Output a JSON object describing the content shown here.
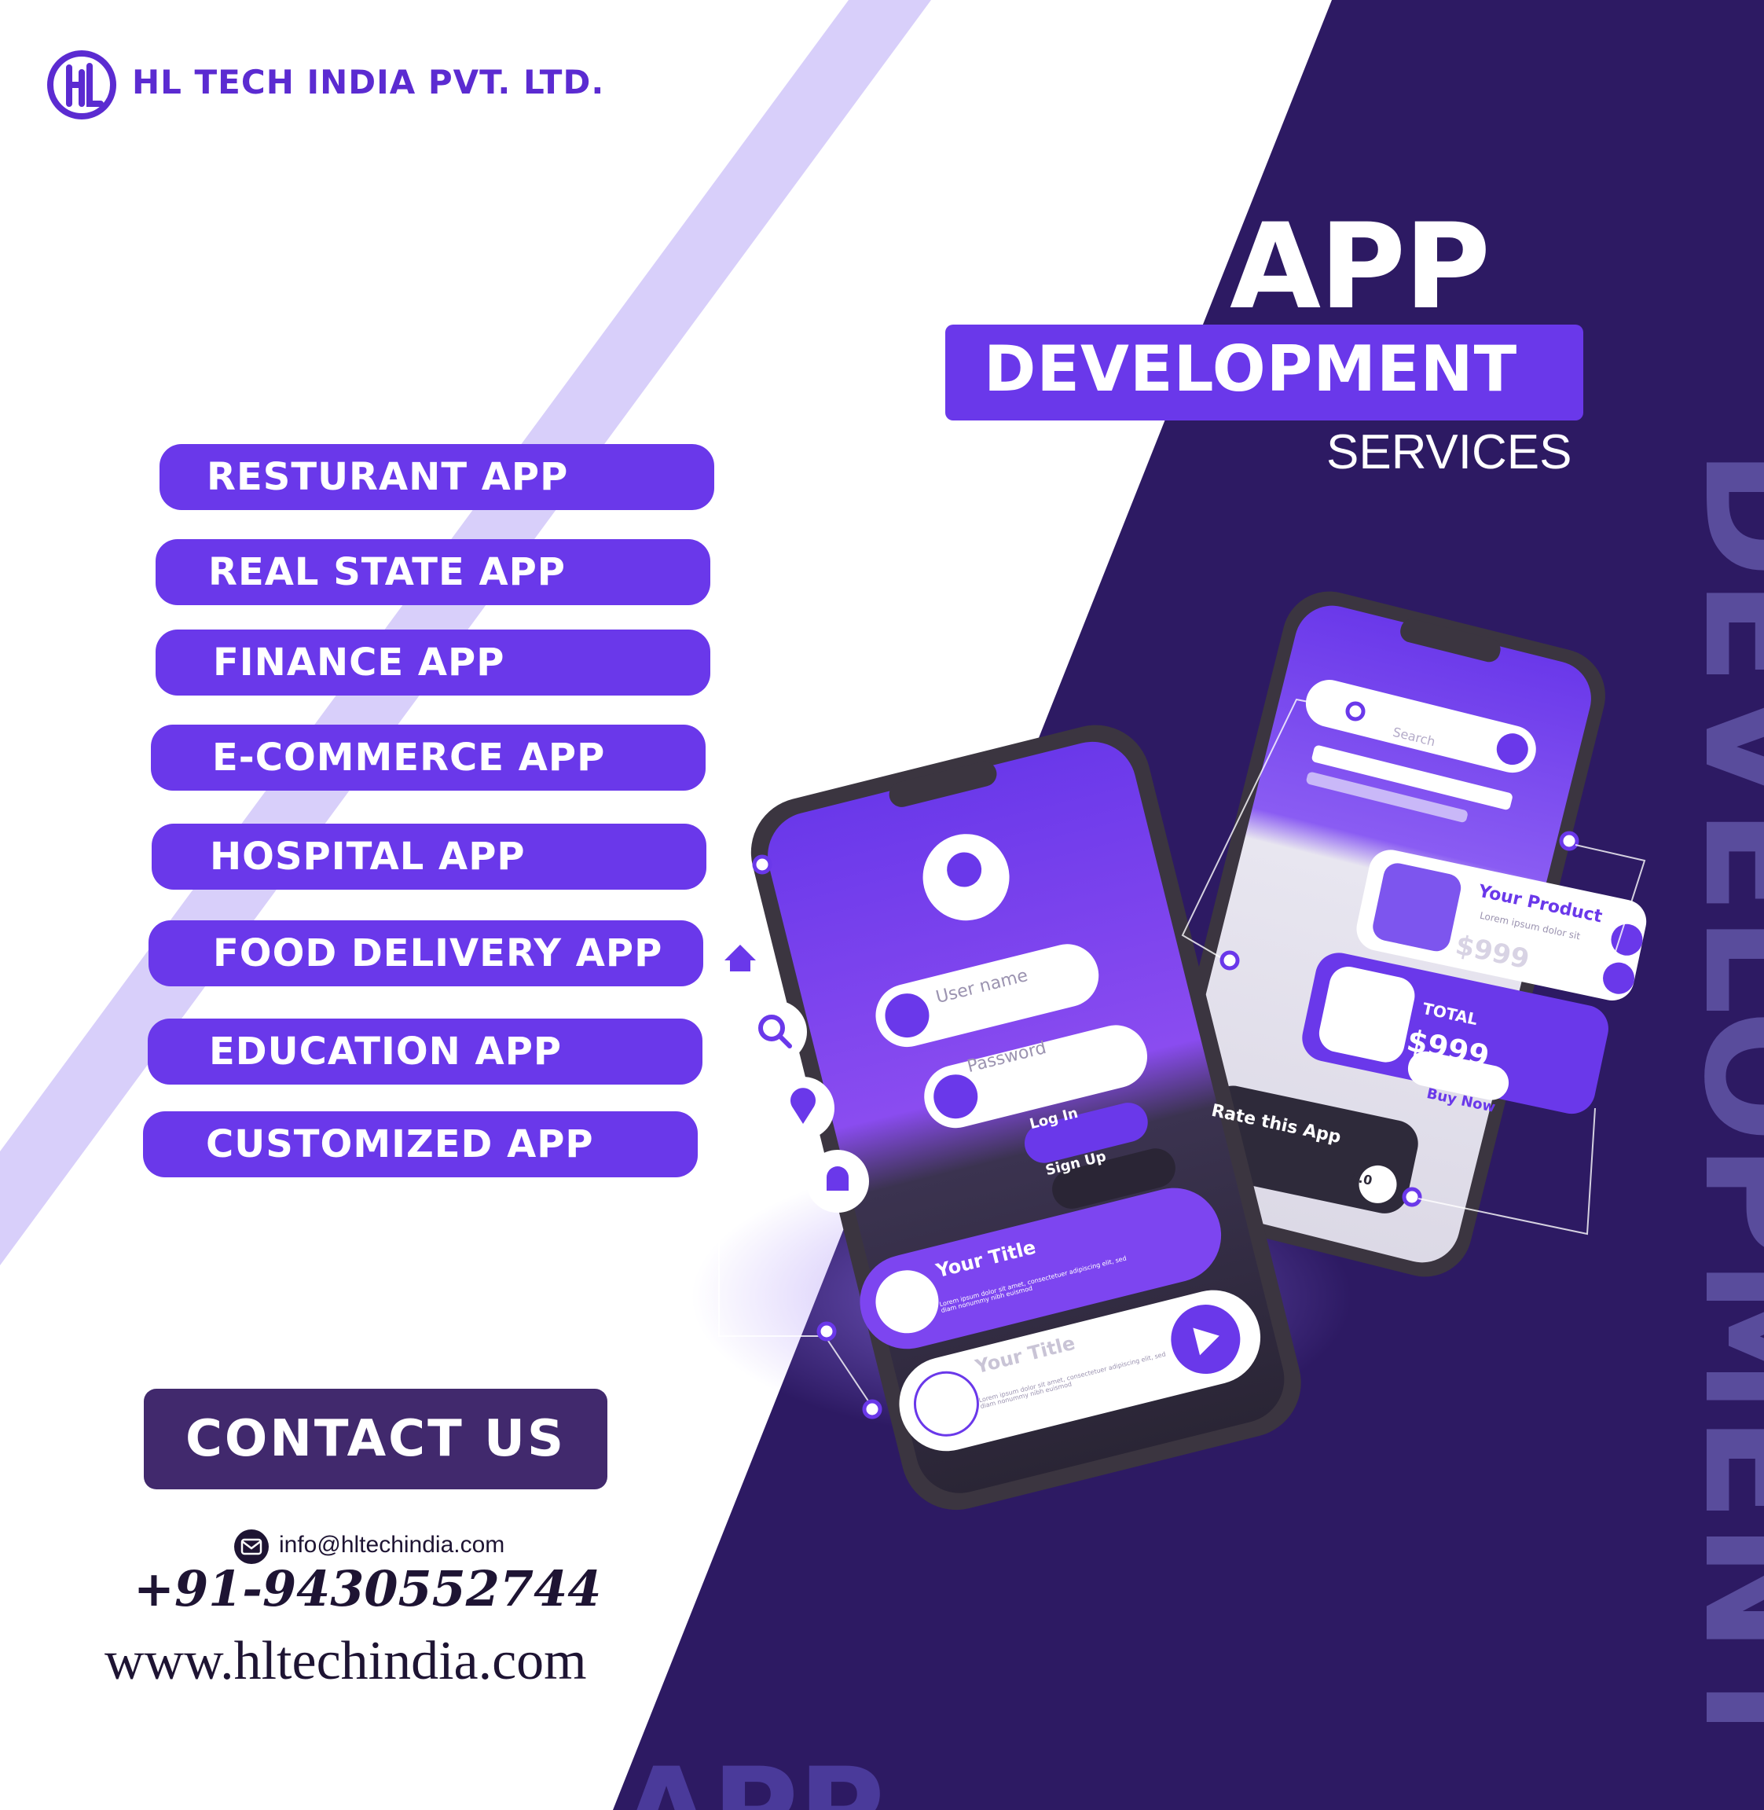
{
  "brand": {
    "name": "HL TECH INDIA PVT. LTD.",
    "logo_icon": "hl-monogram-icon"
  },
  "headline": {
    "line1": "APP",
    "line2": "DEVELOPMENT",
    "line3": "SERVICES"
  },
  "watermark": {
    "vertical": "DEVELOPMENT",
    "bottom": "APP"
  },
  "services": [
    "RESTURANT APP",
    "REAL STATE APP",
    "FINANCE APP",
    "E-COMMERCE APP",
    "HOSPITAL APP",
    "FOOD DELIVERY APP",
    "EDUCATION APP",
    "CUSTOMIZED APP"
  ],
  "contact": {
    "button_label": "CONTACT US",
    "email": "info@hltechindia.com",
    "phone": "+91-9430552744",
    "website": "www.hltechindia.com"
  },
  "mockup_left": {
    "username_placeholder": "User name",
    "password_placeholder": "Password",
    "login_label": "Log In",
    "signup_label": "Sign Up",
    "card1_title": "Your Title",
    "card1_body": "Lorem ipsum dolor sit amet, consectetuer adipiscing elit, sed diam nonummy nibh euismod",
    "card2_title": "Your Title",
    "card2_body": "Lorem ipsum dolor sit amet, consectetuer adipiscing elit, sed diam nonummy nibh euismod"
  },
  "mockup_right": {
    "search_placeholder": "Search",
    "product_title": "Your Product",
    "product_desc": "Lorem ipsum dolor sit",
    "product_price": "$999",
    "total_label": "TOTAL",
    "total_price": "$999",
    "buy_label": "Buy Now",
    "rate_label": "Rate this App",
    "rating": "4.0"
  },
  "colors": {
    "purple": "#6a38ea",
    "dark_purple": "#2d1a63",
    "lavender": "#d8cffa",
    "contact_bg": "#41296d",
    "text_dark": "#1e1433"
  }
}
